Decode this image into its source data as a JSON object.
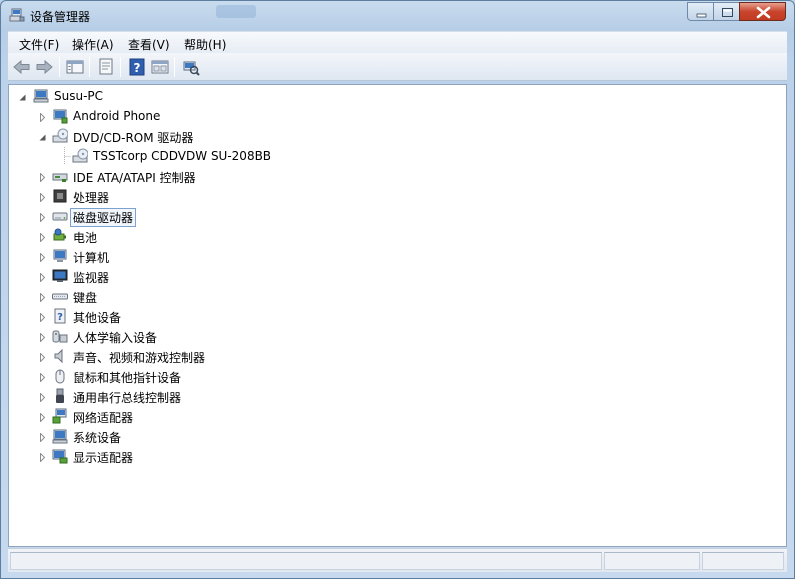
{
  "window": {
    "title": "设备管理器",
    "controls": {
      "minimize": "minimize",
      "maximize": "maximize",
      "close": "close"
    }
  },
  "menu": {
    "items": [
      {
        "label": "文件(F)"
      },
      {
        "label": "操作(A)"
      },
      {
        "label": "查看(V)"
      },
      {
        "label": "帮助(H)"
      }
    ]
  },
  "toolbar": {
    "buttons": [
      {
        "icon": "back-arrow-icon"
      },
      {
        "icon": "forward-arrow-icon"
      },
      {
        "icon": "show-hide-tree-icon"
      },
      {
        "icon": "properties-icon"
      },
      {
        "icon": "help-icon"
      },
      {
        "icon": "console-view-icon"
      },
      {
        "icon": "scan-hardware-icon"
      }
    ]
  },
  "tree": {
    "root": {
      "label": "Susu-PC",
      "icon": "computer-icon",
      "expanded": true
    },
    "nodes": [
      {
        "label": "Android Phone",
        "icon": "android-phone-icon",
        "expanded": false
      },
      {
        "label": "DVD/CD-ROM 驱动器",
        "icon": "dvd-drive-icon",
        "expanded": true,
        "children": [
          {
            "label": "TSSTcorp CDDVDW SU-208BB",
            "icon": "dvd-drive-icon"
          }
        ]
      },
      {
        "label": "IDE ATA/ATAPI 控制器",
        "icon": "ide-controller-icon",
        "expanded": false
      },
      {
        "label": "处理器",
        "icon": "processor-icon",
        "expanded": false
      },
      {
        "label": "磁盘驱动器",
        "icon": "disk-drive-icon",
        "expanded": false,
        "focused": true
      },
      {
        "label": "电池",
        "icon": "battery-icon",
        "expanded": false
      },
      {
        "label": "计算机",
        "icon": "computer-node-icon",
        "expanded": false
      },
      {
        "label": "监视器",
        "icon": "monitor-icon",
        "expanded": false
      },
      {
        "label": "键盘",
        "icon": "keyboard-icon",
        "expanded": false
      },
      {
        "label": "其他设备",
        "icon": "unknown-device-icon",
        "expanded": false
      },
      {
        "label": "人体学输入设备",
        "icon": "hid-icon",
        "expanded": false
      },
      {
        "label": "声音、视频和游戏控制器",
        "icon": "speaker-icon",
        "expanded": false
      },
      {
        "label": "鼠标和其他指针设备",
        "icon": "mouse-icon",
        "expanded": false
      },
      {
        "label": "通用串行总线控制器",
        "icon": "usb-icon",
        "expanded": false
      },
      {
        "label": "网络适配器",
        "icon": "network-adapter-icon",
        "expanded": false
      },
      {
        "label": "系统设备",
        "icon": "system-device-icon",
        "expanded": false
      },
      {
        "label": "显示适配器",
        "icon": "display-adapter-icon",
        "expanded": false
      }
    ]
  },
  "colors": {
    "accent": "#3c7fb1",
    "selection_border": "#7da2ce",
    "close_red": "#c8452c"
  }
}
